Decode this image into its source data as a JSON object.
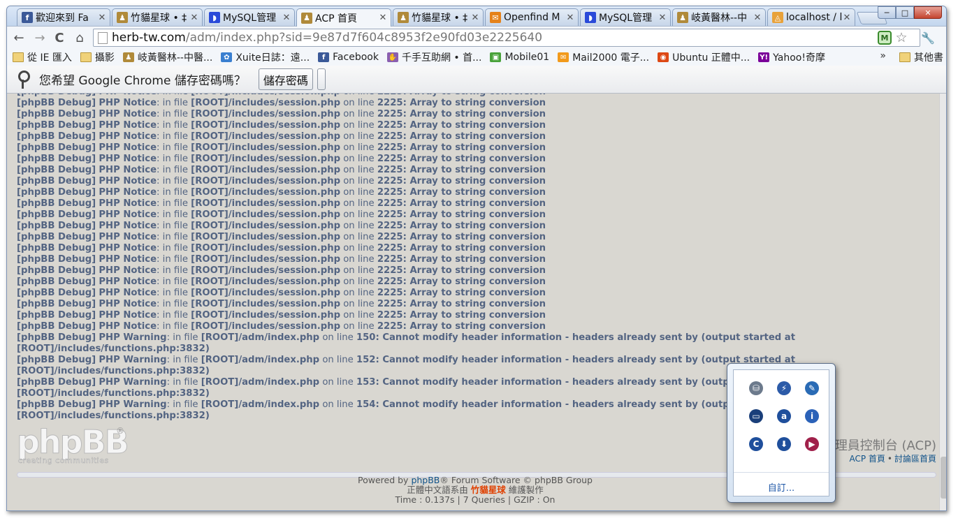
{
  "tabs": [
    {
      "label": "歡迎來到 Fa",
      "icon": "facebook-icon",
      "color": "#3b5998",
      "glyph": "f"
    },
    {
      "label": "竹貓星球 • ‡",
      "icon": "chumao-favicon",
      "color": "#b08a3a",
      "glyph": "♟"
    },
    {
      "label": "MySQL管理",
      "icon": "mysql-icon",
      "color": "#2a4ad9",
      "glyph": "◗"
    },
    {
      "label": "ACP 首頁",
      "icon": "chumao-favicon",
      "color": "#b08a3a",
      "glyph": "♟"
    },
    {
      "label": "竹貓星球 • ‡",
      "icon": "chumao-favicon",
      "color": "#b08a3a",
      "glyph": "♟"
    },
    {
      "label": "Openfind M",
      "icon": "openfind-icon",
      "color": "#e5821a",
      "glyph": "✉"
    },
    {
      "label": "MySQL管理",
      "icon": "mysql-icon",
      "color": "#2a4ad9",
      "glyph": "◗"
    },
    {
      "label": "岐黃醫林--中",
      "icon": "herb-favicon",
      "color": "#b08a3a",
      "glyph": "♟"
    },
    {
      "label": "localhost / l",
      "icon": "phpmyadmin-icon",
      "color": "#e8a23b",
      "glyph": "◬"
    }
  ],
  "active_tab_index": 3,
  "window_buttons": {
    "minimize": "─",
    "maximize": "□",
    "close": "✕"
  },
  "toolbar": {
    "back": "←",
    "forward": "→",
    "reload": "C",
    "home": "⌂",
    "url_host": "herb-tw.com",
    "url_path": "/adm/index.php?sid=9e87d7f604c8953f2e90fd03e2225640",
    "star": "☆",
    "ext_badge": "M",
    "wrench": "🔧"
  },
  "bookmarks": [
    {
      "label": "從 IE 匯入",
      "icon": "folder-icon",
      "kind": "folder"
    },
    {
      "label": "攝影",
      "icon": "folder-icon",
      "kind": "folder"
    },
    {
      "label": "岐黃醫林--中醫...",
      "icon": "herb-favicon",
      "color": "#b08a3a",
      "glyph": "♟"
    },
    {
      "label": "Xuite日誌：遠...",
      "icon": "xuite-icon",
      "color": "#3a7fd0",
      "glyph": "✿"
    },
    {
      "label": "Facebook",
      "icon": "facebook-icon",
      "color": "#3b5998",
      "glyph": "f"
    },
    {
      "label": "千手互助網 • 首...",
      "icon": "qianshou-icon",
      "color": "#8a5fb0",
      "glyph": "✋"
    },
    {
      "label": "Mobile01",
      "icon": "mobile01-icon",
      "color": "#49a23a",
      "glyph": "▣"
    },
    {
      "label": "Mail2000 電子...",
      "icon": "mail2000-icon",
      "color": "#f29a1b",
      "glyph": "✉"
    },
    {
      "label": "Ubuntu 正體中...",
      "icon": "ubuntu-icon",
      "color": "#dd4814",
      "glyph": "◉"
    },
    {
      "label": "Yahoo!奇摩",
      "icon": "yahoo-icon",
      "color": "#7b0099",
      "glyph": "Y!"
    }
  ],
  "bookmarks_more": "»",
  "bookmarks_other": "其他書",
  "infobar": {
    "message": "您希望 Google Chrome 儲存密碼嗎？",
    "save_button": "儲存密碼"
  },
  "debug": {
    "prefix": "[phpBB Debug]",
    "notice_type": "PHP Notice",
    "warning_type": "PHP Warning",
    "in_file": ": in file ",
    "on_line": " on line ",
    "notice_file": "[ROOT]/includes/session.php",
    "notice_line": "2225",
    "notice_msg": ": Array to string conversion",
    "notice_count": 22,
    "warnings": [
      {
        "file": "[ROOT]/adm/index.php",
        "line": "150",
        "msg": ": Cannot modify header information - headers already sent by (output started at",
        "cont": "[ROOT]/includes/functions.php:3832)"
      },
      {
        "file": "[ROOT]/adm/index.php",
        "line": "152",
        "msg": ": Cannot modify header information - headers already sent by (output started at",
        "cont": "[ROOT]/includes/functions.php:3832)"
      },
      {
        "file": "[ROOT]/adm/index.php",
        "line": "153",
        "msg": ": Cannot modify header information - headers already sent by (output started at",
        "cont": "[ROOT]/includes/functions.php:3832)"
      },
      {
        "file": "[ROOT]/adm/index.php",
        "line": "154",
        "msg": ": Cannot modify header information - headers already sent by (output started at",
        "cont": "[ROOT]/includes/functions.php:3832)"
      }
    ]
  },
  "logo": {
    "word": "phpBB",
    "reg": "®",
    "tagline": "creating  communities"
  },
  "acp": {
    "title": "理員控制台 (ACP)",
    "link_home": "ACP 首頁",
    "separator": "•",
    "link_forum": "討論區首頁"
  },
  "footer": {
    "powered_prefix": "Powered by ",
    "powered_link": "phpBB",
    "powered_suffix": "® Forum Software © phpBB Group",
    "translation_prefix": "正體中文語系由 ",
    "translation_link": "竹貓星球",
    "translation_suffix": " 維護製作",
    "stats": "Time : 0.137s | 7 Queries | GZIP : On"
  },
  "tray": {
    "icons": [
      {
        "name": "network-drive-icon",
        "color": "#6c7a8c",
        "glyph": "⛁"
      },
      {
        "name": "power-bolt-icon",
        "color": "#2c5ba8",
        "glyph": "⚡"
      },
      {
        "name": "wrench-tool-icon",
        "color": "#2a6bb5",
        "glyph": "✎"
      },
      {
        "name": "monitor-icon",
        "color": "#1a3f7a",
        "glyph": "▭"
      },
      {
        "name": "a-circle-icon",
        "color": "#1f4f9c",
        "glyph": "a"
      },
      {
        "name": "info-icon",
        "color": "#2b62b8",
        "glyph": "i"
      },
      {
        "name": "c-circle-icon",
        "color": "#1f4f9c",
        "glyph": "C"
      },
      {
        "name": "download-arrow-icon",
        "color": "#1f4f9c",
        "glyph": "⬇"
      },
      {
        "name": "media-play-icon",
        "color": "#a0204a",
        "glyph": "▶"
      }
    ],
    "customize": "自訂..."
  }
}
